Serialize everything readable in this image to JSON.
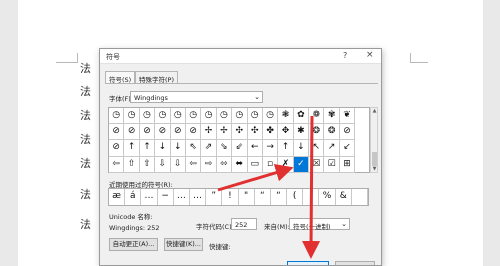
{
  "document": {
    "lines": [
      "法",
      "法",
      "法",
      "法",
      "法",
      "法",
      "法"
    ]
  },
  "dialog": {
    "title": "符号",
    "help_glyph": "?",
    "close_glyph": "×",
    "tabs": [
      {
        "label": "符号(S)",
        "active": true
      },
      {
        "label": "特殊字符(P)",
        "active": false
      }
    ],
    "font_label": "字体(F):",
    "font_value": "Wingdings",
    "symbols": [
      [
        "◷",
        "◷",
        "◷",
        "◷",
        "◷",
        "◷",
        "◷",
        "◷",
        "◷",
        "◷",
        "◷",
        "❃",
        "✿",
        "❁",
        "✾",
        "❦"
      ],
      [
        "⊘",
        "⊘",
        "⊘",
        "⊘",
        "⊘",
        "⊘",
        "✢",
        "✢",
        "✣",
        "✣",
        "✤",
        "✥",
        "✱",
        "❂",
        "❂",
        "⊘"
      ],
      [
        "⊘",
        "↑",
        "↑",
        "↓",
        "↓",
        "⇖",
        "⇗",
        "⇘",
        "⇙",
        "←",
        "→",
        "↑",
        "↓",
        "↖",
        "↗",
        "↙"
      ],
      [
        "⇦",
        "⇧",
        "⇧",
        "⇩",
        "⇩",
        "⇦",
        "⇨",
        "⬄",
        "⬌",
        "▭",
        "▫",
        "✗",
        "✓",
        "☒",
        "☑",
        "⊞"
      ]
    ],
    "selected_symbol": {
      "row": 3,
      "col": 12
    },
    "recent_label": "近期使用过的符号(R):",
    "recent_symbols": [
      "æ",
      "á",
      "…",
      "−",
      "…",
      "…",
      "”",
      "!",
      "\"",
      "“",
      "“",
      "(",
      ")",
      "%",
      "&",
      ""
    ],
    "unicode_name_label": "Unicode 名称:",
    "char_name": "Wingdings: 252",
    "code_label": "字符代码(C):",
    "code_value": "252",
    "from_label": "来自(M):",
    "from_value": "符号(十进制)",
    "autocorrect_button": "自动更正(A)...",
    "shortcut_key_button": "快捷键(K)...",
    "shortcut_label": "快捷键:"
  },
  "colors": {
    "selection": "#0078d7",
    "annotation_arrow": "#e03030"
  }
}
